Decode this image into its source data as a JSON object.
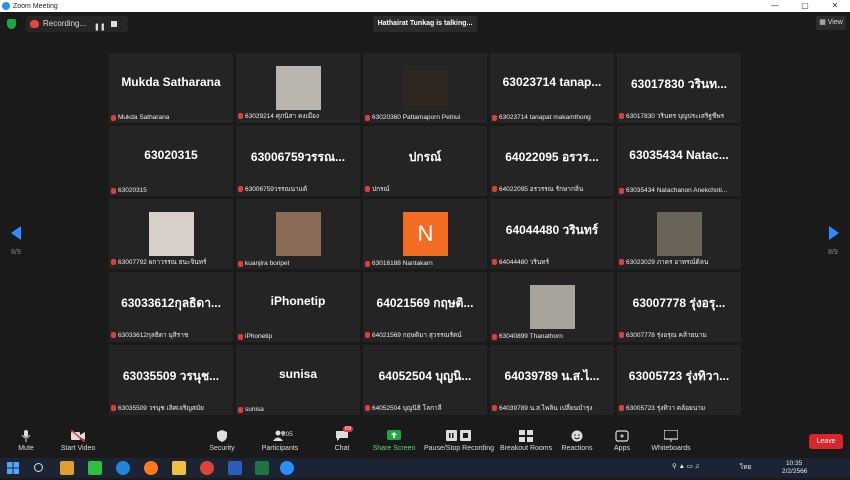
{
  "window": {
    "title": "Zoom Meeting"
  },
  "topbar": {
    "recording_label": "Recording...",
    "talking_label": "Hathairat Tunkag is talking...",
    "view_label": "View"
  },
  "pagination": {
    "left": "8/9",
    "right": "8/9"
  },
  "tiles": [
    {
      "big": "Mukda Satharana",
      "label": "Mukda Satharana"
    },
    {
      "big": "",
      "label": "63029214 ศุภนิสา คงเมือง",
      "photo": "#b9b4ae"
    },
    {
      "big": "",
      "label": "63020360 Pattamaporn Petnui",
      "photo": "#2e2621"
    },
    {
      "big": "63023714 tanap...",
      "label": "63023714 tanapat makamthong"
    },
    {
      "big": "63017830 วรินท...",
      "label": "63017830 วรินทร บุญประเสริฐชีพร"
    },
    {
      "big": "63020315",
      "label": "63020315"
    },
    {
      "big": "63006759วรรณ...",
      "label": "63006759วรรณนาแต้"
    },
    {
      "big": "ปกรณ์",
      "label": "ปกรณ์"
    },
    {
      "big": "64022095 อรวร...",
      "label": "64022095 อรวรรณ รักษากลิ่น"
    },
    {
      "big": "63035434 Natac...",
      "label": "63035434 Natachanon Anekchoti..."
    },
    {
      "big": "",
      "label": "63007792 ผกาวรรณ ธนะจินทร์",
      "photo": "#d9cfca"
    },
    {
      "big": "",
      "label": "kuanjira boripet",
      "photo": "#8c6a58"
    },
    {
      "big": "",
      "label": "63016188 Nantakarn",
      "photo": "#f26d21",
      "letter": "N"
    },
    {
      "big": "64044480 วรินทร์",
      "label": "64044480 วรินทร์"
    },
    {
      "big": "",
      "label": "63023029 ภาคร อาทรณ์ดิลน",
      "photo": "#6a6458"
    },
    {
      "big": "63033612กุลธิดา...",
      "label": "63033612กุลธิดา มุสิราช"
    },
    {
      "big": "iPhonetip",
      "label": "iPhonetip"
    },
    {
      "big": "64021569 กฤษติ...",
      "label": "64021569 กฤษติมา สุวรรณรัตน์"
    },
    {
      "big": "",
      "label": "63040899 Thanathorn",
      "photo": "#a8a49c"
    },
    {
      "big": "63007778 รุ่งอรุ...",
      "label": "63007778 รุ่งอรุณ คล้ายนาม"
    },
    {
      "big": "63035509 วรนุช...",
      "label": "63035509 วรนุช เลิศเจริญสมัย"
    },
    {
      "big": "sunisa",
      "label": "sunisa"
    },
    {
      "big": "64052504 บุญนิ...",
      "label": "64052504 บุญนิธิ โลกาลี"
    },
    {
      "big": "64039789 น.ส.ไ...",
      "label": "64039789 น.ส.ไพลิน เปลี่ยนบำรุง"
    },
    {
      "big": "63005723 รุ่งทิวา...",
      "label": "63005723 รุ่งทิวา คล้อยนาม"
    }
  ],
  "toolbar": {
    "mute": "Mute",
    "start_video": "Start Video",
    "security": "Security",
    "participants": "Participants",
    "participants_count": "205",
    "chat": "Chat",
    "chat_badge": "69",
    "share_screen": "Share Screen",
    "pause_recording": "Pause/Stop Recording",
    "breakout": "Breakout Rooms",
    "reactions": "Reactions",
    "apps": "Apps",
    "whiteboards": "Whiteboards",
    "leave": "Leave"
  },
  "taskbar": {
    "lang": "ไทย",
    "time": "10:35",
    "date": "2/2/2566"
  },
  "colors": {
    "accent": "#2d8cff",
    "leave": "#d8262c",
    "share": "#1fa83a"
  }
}
